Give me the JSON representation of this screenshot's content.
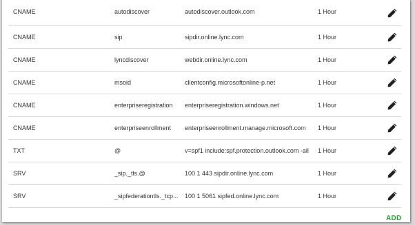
{
  "records": [
    {
      "type": "CNAME",
      "host": "autodiscover",
      "value": "autodiscover.outlook.com",
      "ttl": "1 Hour"
    },
    {
      "type": "CNAME",
      "host": "sip",
      "value": "sipdir.online.lync.com",
      "ttl": "1 Hour"
    },
    {
      "type": "CNAME",
      "host": "lyncdiscover",
      "value": "webdir.online.lync.com",
      "ttl": "1 Hour"
    },
    {
      "type": "CNAME",
      "host": "msoid",
      "value": "clientconfig.microsoftonline-p.net",
      "ttl": "1 Hour"
    },
    {
      "type": "CNAME",
      "host": "enterpriseregistration",
      "value": "enterpriseregistration.windows.net",
      "ttl": "1 Hour"
    },
    {
      "type": "CNAME",
      "host": "enterpriseenrollment",
      "value": "enterpriseenrollment.manage.microsoft.com",
      "ttl": "1 Hour"
    },
    {
      "type": "TXT",
      "host": "@",
      "value": "v=spf1 include:spf.protection.outlook.com -all",
      "ttl": "1 Hour"
    },
    {
      "type": "SRV",
      "host": "_sip._tls.@",
      "value": "100 1 443 sipdir.online.lync.com",
      "ttl": "1 Hour"
    },
    {
      "type": "SRV",
      "host": "_sipfederationtls._tcp...",
      "value": "100 1 5061 sipfed.online.lync.com",
      "ttl": "1 Hour"
    }
  ],
  "edit_icon": "pencil-icon",
  "add_label": "ADD",
  "colors": {
    "add": "#2f9e3c",
    "text": "#333333",
    "divider": "#d8d8d8",
    "icon": "#222222"
  }
}
